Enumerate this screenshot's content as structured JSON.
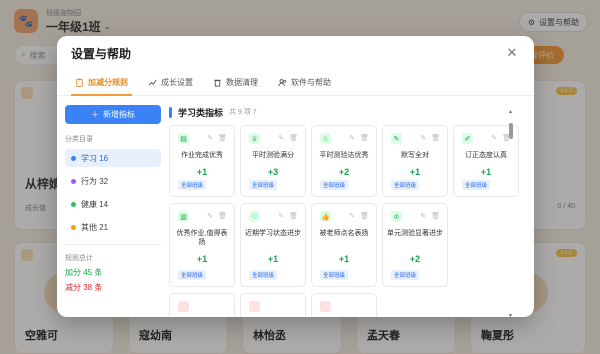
{
  "app": {
    "brand_sub": "班级宠物园",
    "class_name": "一年级1班",
    "settings_button": "设置与帮助",
    "search_placeholder": "搜索",
    "action_button": "导评价",
    "level_badge": "Lv.1",
    "bg_name_partial": "从梓婧",
    "bg_exp_label": "成长值",
    "bg_progress": "0 / 40",
    "students": [
      "空雅可",
      "寇幼南",
      "林怡丞",
      "孟天春",
      "鞠夏彤"
    ]
  },
  "modal": {
    "title": "设置与帮助",
    "close_icon": "close-icon",
    "tabs": [
      {
        "label": "加减分规则",
        "icon": "clipboard-icon",
        "active": true
      },
      {
        "label": "成长设置",
        "icon": "trend-icon",
        "active": false
      },
      {
        "label": "数据清理",
        "icon": "trash-icon",
        "active": false
      },
      {
        "label": "软件与帮助",
        "icon": "users-icon",
        "active": false
      }
    ],
    "add_button": "新增指标",
    "category_label": "分类目录",
    "categories": [
      {
        "label": "学习 16",
        "color": "#3b82f6",
        "active": true
      },
      {
        "label": "行为 32",
        "color": "#a855f7",
        "active": false
      },
      {
        "label": "健康 14",
        "color": "#22c55e",
        "active": false
      },
      {
        "label": "其他 21",
        "color": "#f59e0b",
        "active": false
      }
    ],
    "rule_total_label": "规则总计",
    "plus_rules": "加分 45 条",
    "minus_rules": "减分 38 条",
    "section_title": "学习类指标",
    "section_count": "共 9 项 7",
    "tag_text": "全部班级",
    "indicators": [
      {
        "name": "作业完成优秀",
        "score": "+1",
        "color": "#dcfce7",
        "glyph": "▤"
      },
      {
        "name": "平时测验满分",
        "score": "+3",
        "color": "#dcfce7",
        "glyph": "♕"
      },
      {
        "name": "平时测验达优秀",
        "score": "+2",
        "color": "#dcfce7",
        "glyph": "☆"
      },
      {
        "name": "默写全对",
        "score": "+1",
        "color": "#dcfce7",
        "glyph": "✎"
      },
      {
        "name": "订正态度认真",
        "score": "+1",
        "color": "#dcfce7",
        "glyph": "✐"
      },
      {
        "name": "优秀作业,值得表扬",
        "score": "+1",
        "color": "#dcfce7",
        "glyph": "▥"
      },
      {
        "name": "近期学习状态进步",
        "score": "+1",
        "color": "#dcfce7",
        "glyph": "♡"
      },
      {
        "name": "被老师点名表扬",
        "score": "+1",
        "color": "#dcfce7",
        "glyph": "👍"
      },
      {
        "name": "单元测验显著进步",
        "score": "+2",
        "color": "#dcfce7",
        "glyph": "♔"
      }
    ],
    "more_row_colors": [
      "#fee2e2",
      "#fee2e2",
      "#fee2e2"
    ]
  }
}
